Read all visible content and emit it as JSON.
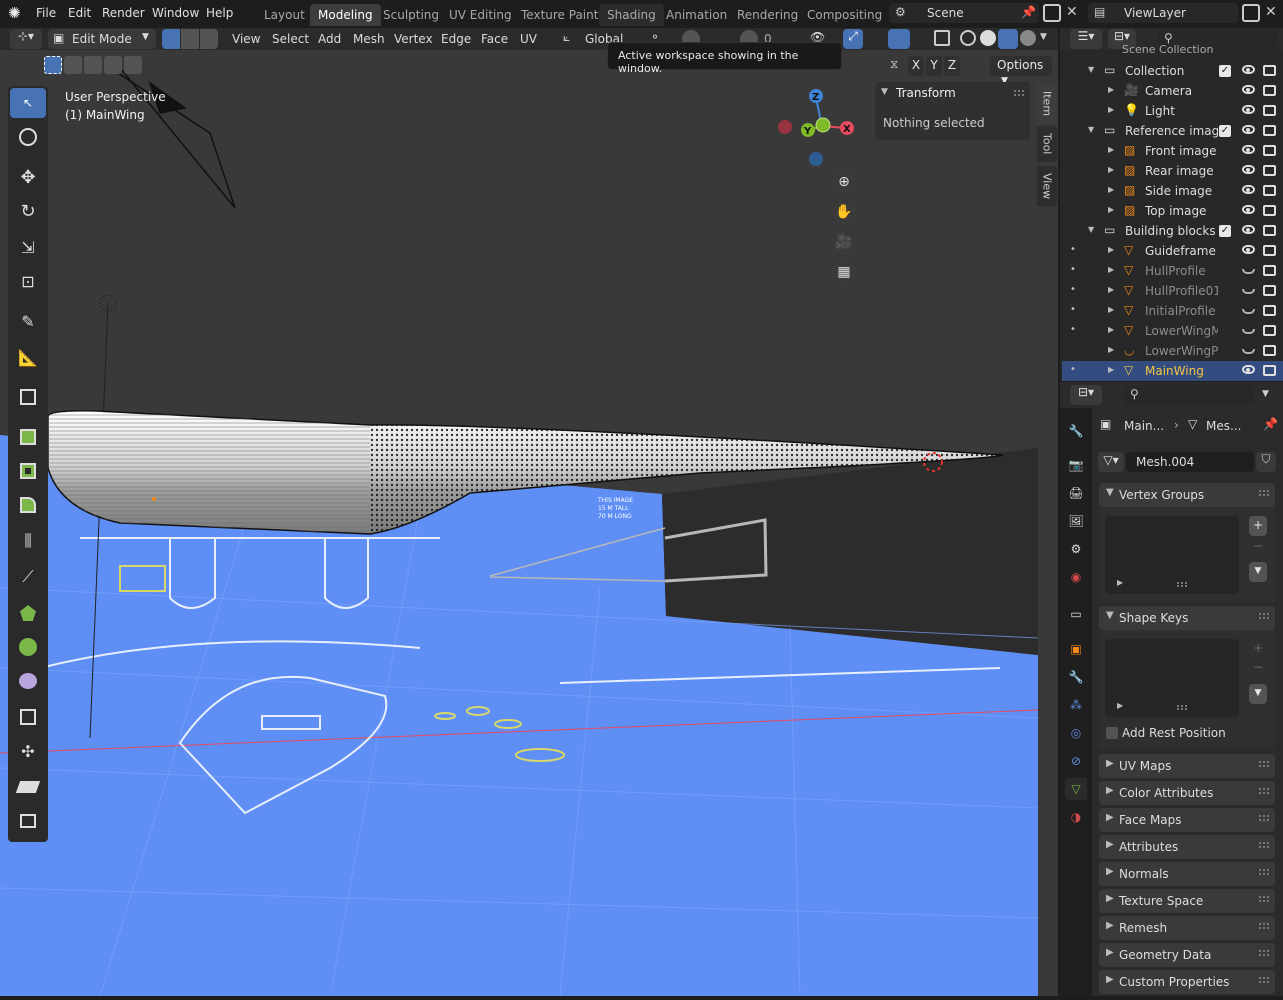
{
  "menu": {
    "file": "File",
    "edit": "Edit",
    "render": "Render",
    "window": "Window",
    "help": "Help"
  },
  "workspaces": [
    "Layout",
    "Modeling",
    "Sculpting",
    "UV Editing",
    "Texture Paint",
    "Shading",
    "Animation",
    "Rendering",
    "Compositing"
  ],
  "active_workspace": "Modeling",
  "scene": {
    "name": "Scene"
  },
  "view_layer": {
    "name": "ViewLayer"
  },
  "header": {
    "mode": "Edit Mode",
    "view": "View",
    "select": "Select",
    "add": "Add",
    "mesh": "Mesh",
    "vertex": "Vertex",
    "edge": "Edge",
    "face": "Face",
    "uv": "UV",
    "orientation": "Global",
    "snap_value": "0",
    "options": "Options",
    "x": "X",
    "y": "Y",
    "z": "Z"
  },
  "tooltip": "Active workspace showing in the window.",
  "viewport": {
    "perspective": "User Perspective",
    "object": "(1) MainWing",
    "ref_text": [
      "THIS IMAGE",
      "15 M TALL",
      "70 M LONG"
    ]
  },
  "gizmo": {
    "z": "Z",
    "y": "Y",
    "x": "X"
  },
  "n_panel": {
    "title": "Transform",
    "message": "Nothing selected",
    "tabs": [
      "Item",
      "Tool",
      "View"
    ]
  },
  "outliner": {
    "root": "Scene Collection",
    "rows": [
      {
        "name": "Collection",
        "kind": "collection",
        "depth": 0,
        "visible": true
      },
      {
        "name": "Camera",
        "kind": "camera",
        "depth": 1,
        "visible": true
      },
      {
        "name": "Light",
        "kind": "light",
        "depth": 1,
        "visible": true
      },
      {
        "name": "Reference images",
        "kind": "collection",
        "depth": 0,
        "visible": true
      },
      {
        "name": "Front image",
        "kind": "image",
        "depth": 1,
        "visible": true
      },
      {
        "name": "Rear image",
        "kind": "image",
        "depth": 1,
        "visible": true
      },
      {
        "name": "Side image",
        "kind": "image",
        "depth": 1,
        "visible": true
      },
      {
        "name": "Top image",
        "kind": "image",
        "depth": 1,
        "visible": true
      },
      {
        "name": "Building blocks",
        "kind": "collection",
        "depth": 0,
        "visible": true
      },
      {
        "name": "Guideframe",
        "kind": "mesh",
        "depth": 1,
        "visible": true
      },
      {
        "name": "HullProfile",
        "kind": "mesh",
        "depth": 1,
        "visible": false
      },
      {
        "name": "HullProfile01",
        "kind": "mesh",
        "depth": 1,
        "visible": false
      },
      {
        "name": "InitialProfile",
        "kind": "mesh",
        "depth": 1,
        "visible": false
      },
      {
        "name": "LowerWingMe",
        "kind": "mesh",
        "depth": 1,
        "visible": false
      },
      {
        "name": "LowerWingPa",
        "kind": "curve",
        "depth": 1,
        "visible": false
      },
      {
        "name": "MainWing",
        "kind": "mesh",
        "depth": 1,
        "visible": true,
        "selected": true
      }
    ]
  },
  "properties": {
    "breadcrumb_object": "Main...",
    "breadcrumb_data": "Mes...",
    "mesh_name": "Mesh.004",
    "panels_open": [
      "Vertex Groups",
      "Shape Keys"
    ],
    "add_rest_position": "Add Rest Position",
    "panels_closed": [
      "UV Maps",
      "Color Attributes",
      "Face Maps",
      "Attributes",
      "Normals",
      "Texture Space",
      "Remesh",
      "Geometry Data",
      "Custom Properties"
    ]
  },
  "colors": {
    "accent": "#4772b3",
    "selected_row": "#334d80",
    "viewport_bg": "#393939",
    "floor": "#5f8ff5",
    "axis_x": "#e84a5f",
    "axis_y": "#7fb927",
    "axis_z": "#3e84d6"
  }
}
